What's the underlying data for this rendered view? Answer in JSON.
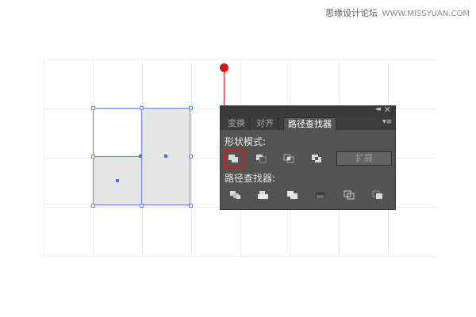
{
  "watermark": {
    "text": "思缘设计论坛",
    "site": "WWW.MISSYUAN.COM"
  },
  "panel": {
    "tabs": [
      {
        "label": "变换"
      },
      {
        "label": "对齐"
      },
      {
        "label": "路径查找器"
      }
    ],
    "active_tab": "路径查找器",
    "shape_modes_label": "形状模式:",
    "pathfinders_label": "路径查找器:",
    "expand_label": "扩展",
    "shape_mode_buttons": [
      "unite-icon",
      "minus-front-icon",
      "intersect-icon",
      "exclude-icon"
    ],
    "pathfinder_buttons": [
      "divide-icon",
      "trim-icon",
      "merge-icon",
      "crop-icon",
      "outline-icon",
      "minus-back-icon"
    ],
    "selected_button": "unite-icon",
    "highlight_color": "#e01818"
  },
  "colors": {
    "selection": "#5e86f5",
    "shape_fill": "#e6e6e6",
    "panel_bg": "#535353"
  }
}
